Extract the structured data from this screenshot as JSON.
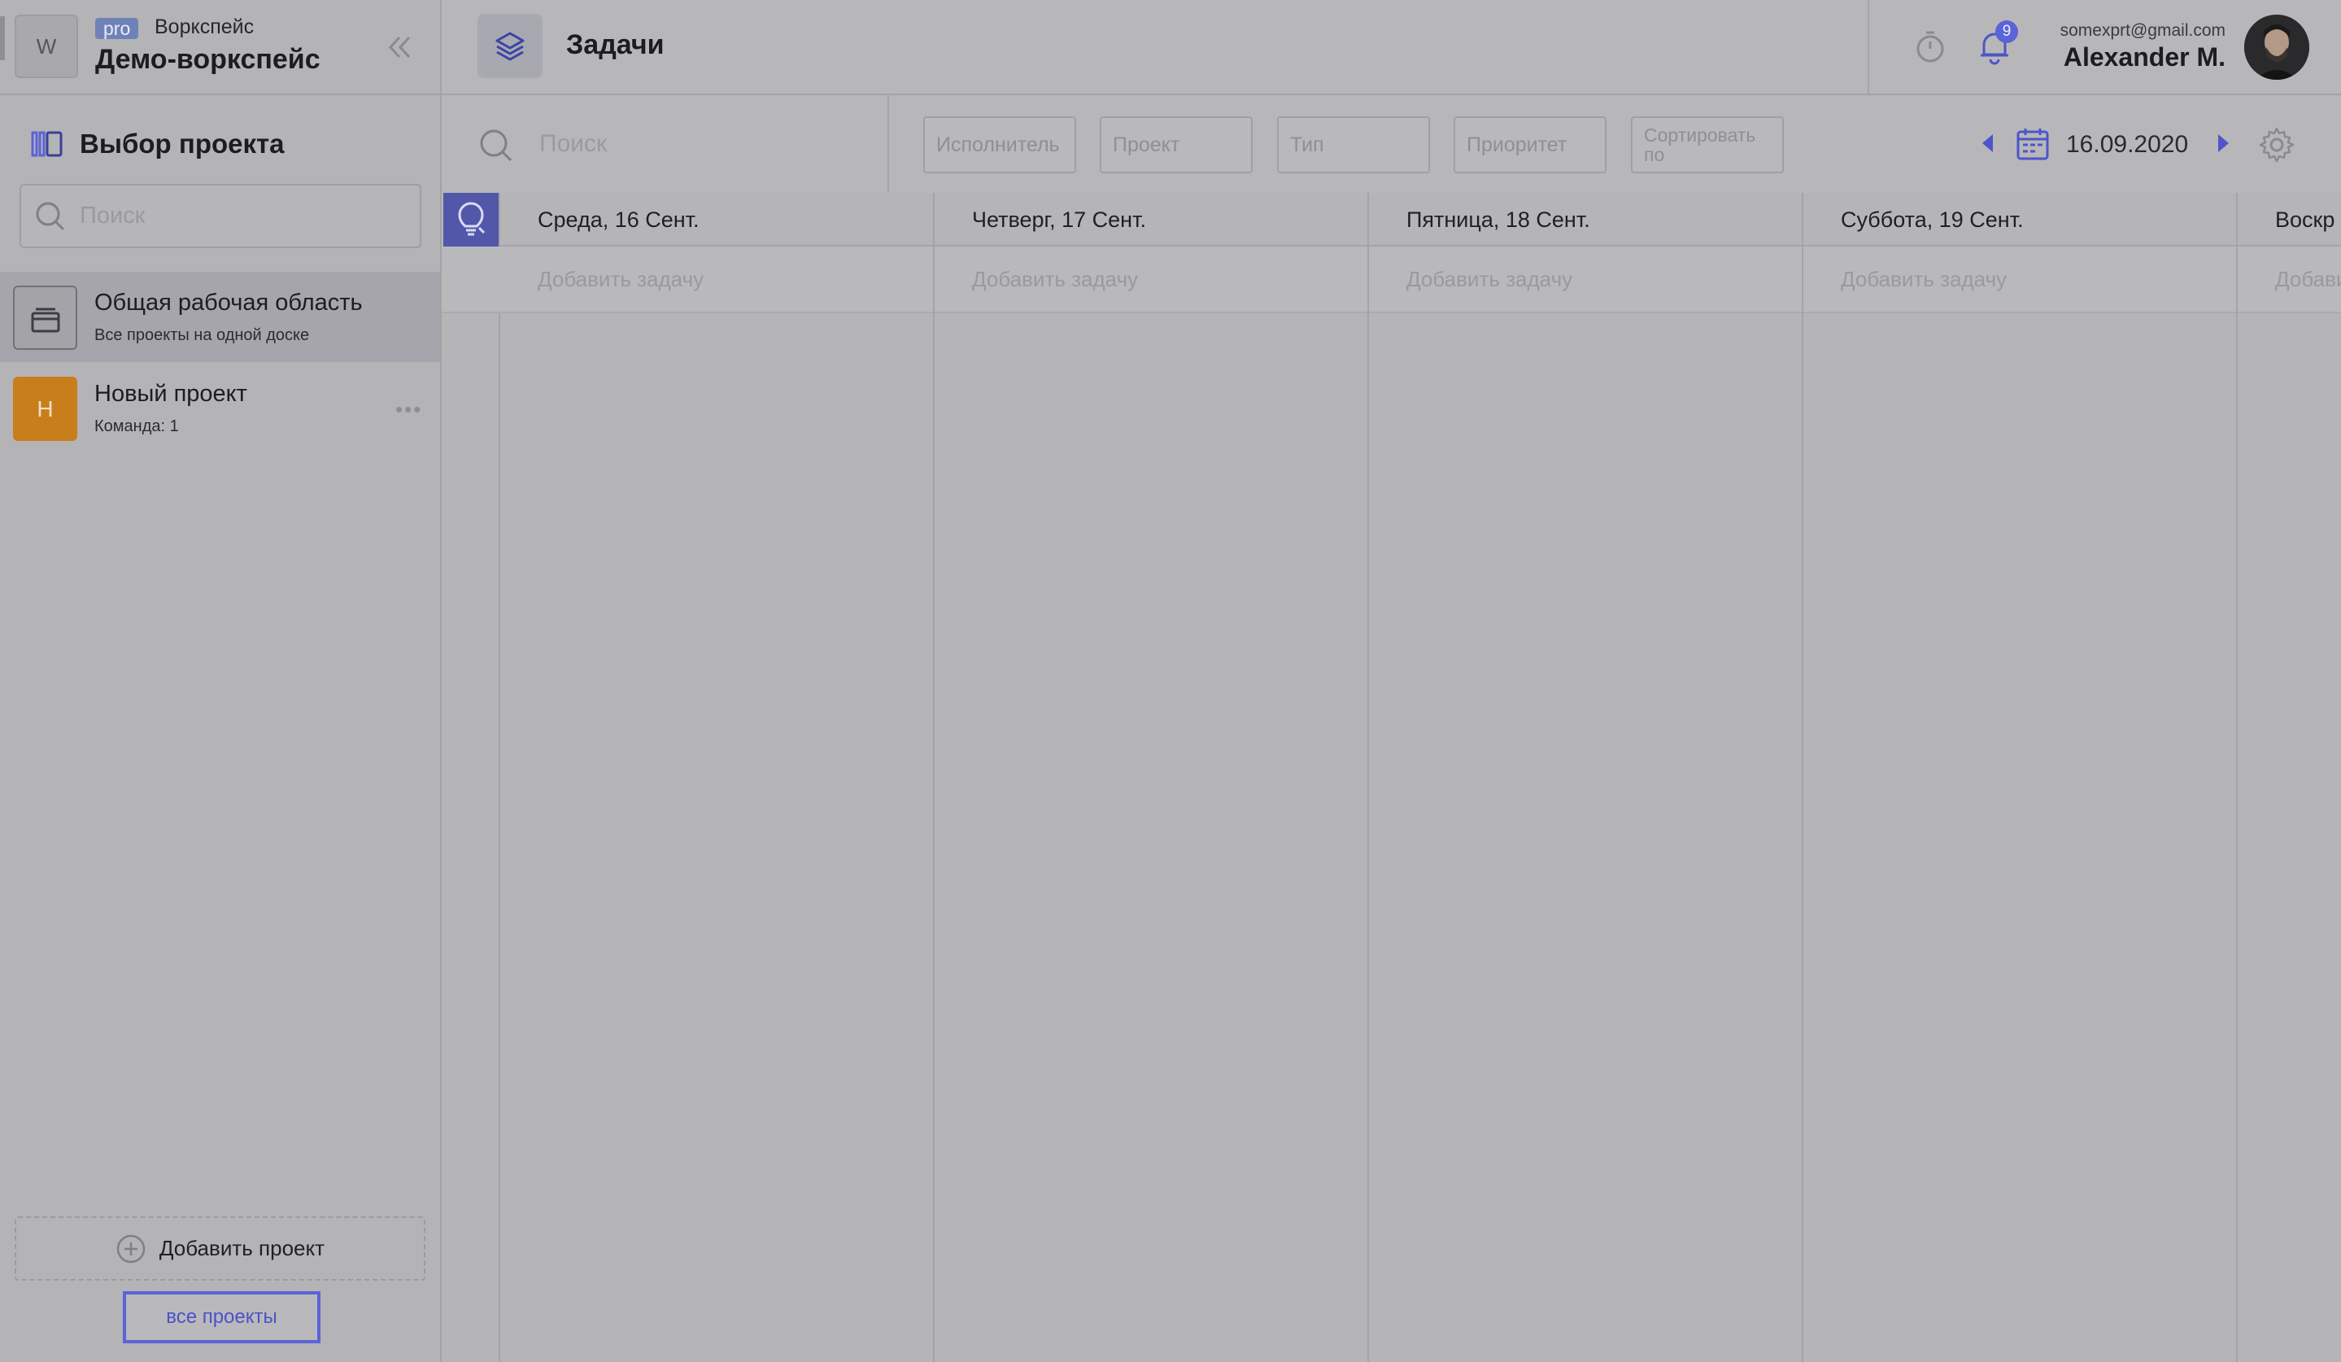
{
  "workspace": {
    "avatar_letter": "W",
    "plan_badge": "pro",
    "label": "Воркспейс",
    "name": "Демо-воркспейс"
  },
  "sidebar": {
    "section_title": "Выбор проекта",
    "search_placeholder": "Поиск",
    "projects": [
      {
        "name": "Общая рабочая область",
        "subtitle": "Все проекты на одной доске",
        "icon": "stack-icon",
        "active": true
      },
      {
        "name": "Новый проект",
        "subtitle": "Команда: 1",
        "avatar_letter": "Н",
        "avatar_color": "#c97e1c",
        "active": false
      }
    ],
    "add_project_label": "Добавить проект",
    "all_projects_label": "все проекты"
  },
  "topbar": {
    "page_title": "Задачи",
    "notifications_count": "9",
    "user_email": "somexprt@gmail.com",
    "user_name": "Alexander M."
  },
  "toolbar": {
    "search_placeholder": "Поиск",
    "filters": {
      "assignee": "Исполнитель",
      "project": "Проект",
      "type": "Тип",
      "priority": "Приоритет",
      "sort": "Сортировать по"
    },
    "date": "16.09.2020"
  },
  "board": {
    "add_task_label": "Добавить задачу",
    "days": [
      "Среда, 16 Сент.",
      "Четверг, 17 Сент.",
      "Пятница, 18 Сент.",
      "Суббота, 19 Сент.",
      "Воскр"
    ]
  },
  "colors": {
    "accent": "#5b63d8",
    "overlay_gray": "#b7b7b9"
  }
}
